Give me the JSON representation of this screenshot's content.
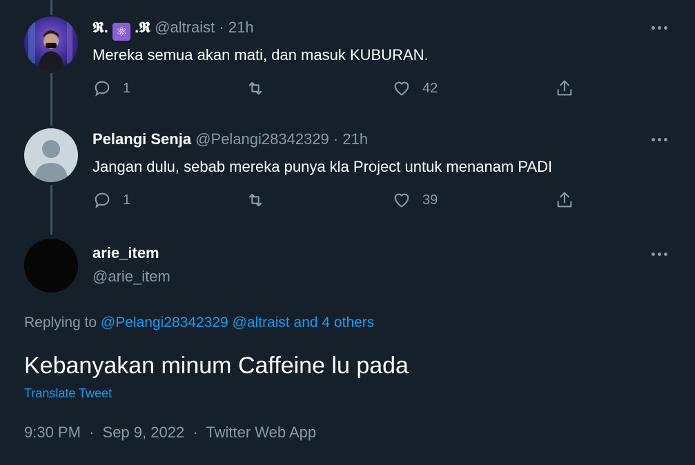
{
  "thread": [
    {
      "display_name_glyphs": "𝕽.",
      "display_name_suffix": ".𝕽",
      "name_emoji": "atom-symbol-emoji",
      "handle": "@altraist",
      "dot": "·",
      "time": "21h",
      "text": "Mereka semua akan mati, dan masuk KUBURAN.",
      "replies": "1",
      "retweets": "",
      "likes": "42"
    },
    {
      "display_name": "Pelangi Senja",
      "handle": "@Pelangi28342329",
      "dot": "·",
      "time": "21h",
      "text": "Jangan dulu, sebab mereka punya kla Project untuk menanam PADI",
      "replies": "1",
      "retweets": "",
      "likes": "39"
    }
  ],
  "main": {
    "display_name": "arie_item",
    "handle": "@arie_item",
    "replying_prefix": "Replying to",
    "replying_users": "@Pelangi28342329 @altraist and 4 others",
    "text": "Kebanyakan minum Caffeine lu pada",
    "translate": "Translate Tweet",
    "time": "9:30 PM",
    "dot1": "·",
    "date": "Sep 9, 2022",
    "dot2": "·",
    "source": "Twitter Web App"
  },
  "colors": {
    "background": "#15202b",
    "secondary_text": "#8b98a5",
    "link": "#1d9bf0",
    "thread_line": "#3d5466"
  }
}
